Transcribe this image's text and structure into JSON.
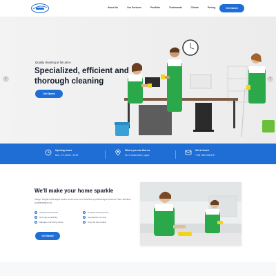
{
  "nav": {
    "logo_icon": "company-logo",
    "links": [
      "About Us",
      "Our Services",
      "Portfolio",
      "Testimonial",
      "Clients",
      "Pricing",
      "Contact Us"
    ],
    "cta": "Get Started"
  },
  "hero": {
    "tagline": "Quality cleaning at fair price",
    "title": "Specialized, efficient and thorough cleaning",
    "button": "Get Started",
    "prev_icon": "chevron-left-icon",
    "next_icon": "chevron-right-icon"
  },
  "info": [
    {
      "icon": "clock-icon",
      "title": "Opening hours",
      "text": "Mon - Fri, 08:00 - 20:00"
    },
    {
      "icon": "map-pin-icon",
      "title": "Where you can find us",
      "text": "No 4, Small world, Lagos"
    },
    {
      "icon": "phone-icon",
      "title": "Get in touch",
      "text": "+234 7812 345 678"
    }
  ],
  "about": {
    "title": "We'll make your home sparkle",
    "text": "Integer feugiat scelerisque varius morbi enim nunc faucibus a pellentesque sit amet. Nunc faucibus a pellentesque sit.",
    "features": [
      "Vetted professionals",
      "Contract cleaning work",
      "Next day availability",
      "Specialized services",
      "Manage everything online",
      "Only the best quality"
    ],
    "button": "Get Started"
  },
  "colors": {
    "accent": "#1e6ed6",
    "apron": "#2aa84a"
  }
}
